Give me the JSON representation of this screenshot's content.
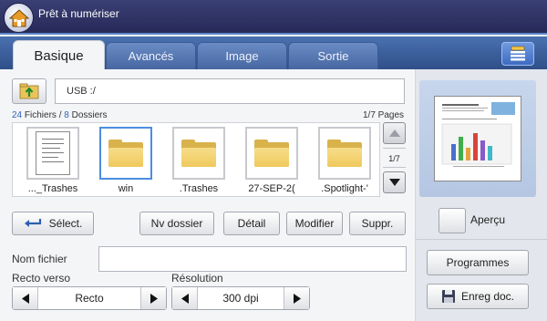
{
  "header": {
    "title": "Prêt à numériser"
  },
  "tabs": [
    {
      "label": "Basique",
      "active": true
    },
    {
      "label": "Avancés",
      "active": false
    },
    {
      "label": "Image",
      "active": false
    },
    {
      "label": "Sortie",
      "active": false
    }
  ],
  "location": {
    "path": "USB :/"
  },
  "summary": {
    "files_count": "24",
    "files_label": "Fichiers /",
    "folders_count": "8",
    "folders_label": "Dossiers",
    "pages": "1/7 Pages"
  },
  "files": [
    {
      "name": "..._Trashes",
      "type": "document"
    },
    {
      "name": "win",
      "type": "folder",
      "selected": true
    },
    {
      "name": ".Trashes",
      "type": "folder"
    },
    {
      "name": "27-SEP-2(",
      "type": "folder"
    },
    {
      "name": ".Spotlight-'",
      "type": "folder"
    }
  ],
  "scroll": {
    "indicator": "1/7"
  },
  "actions": {
    "select": "Sélect.",
    "new_folder": "Nv dossier",
    "detail": "Détail",
    "modify": "Modifier",
    "delete": "Suppr."
  },
  "filename": {
    "label": "Nom fichier",
    "value": ""
  },
  "duplex": {
    "label": "Recto verso",
    "value": "Recto"
  },
  "resolution": {
    "label": "Résolution",
    "value": "300 dpi"
  },
  "preview": {
    "label": "Aperçu"
  },
  "panel": {
    "programs": "Programmes",
    "save_doc": "Enreg doc."
  },
  "colors": {
    "header_bg": "#2c2f5e",
    "tab_bar": "#3b5e9c",
    "accent_blue": "#4b8ee0",
    "folder": "#efc95c"
  }
}
